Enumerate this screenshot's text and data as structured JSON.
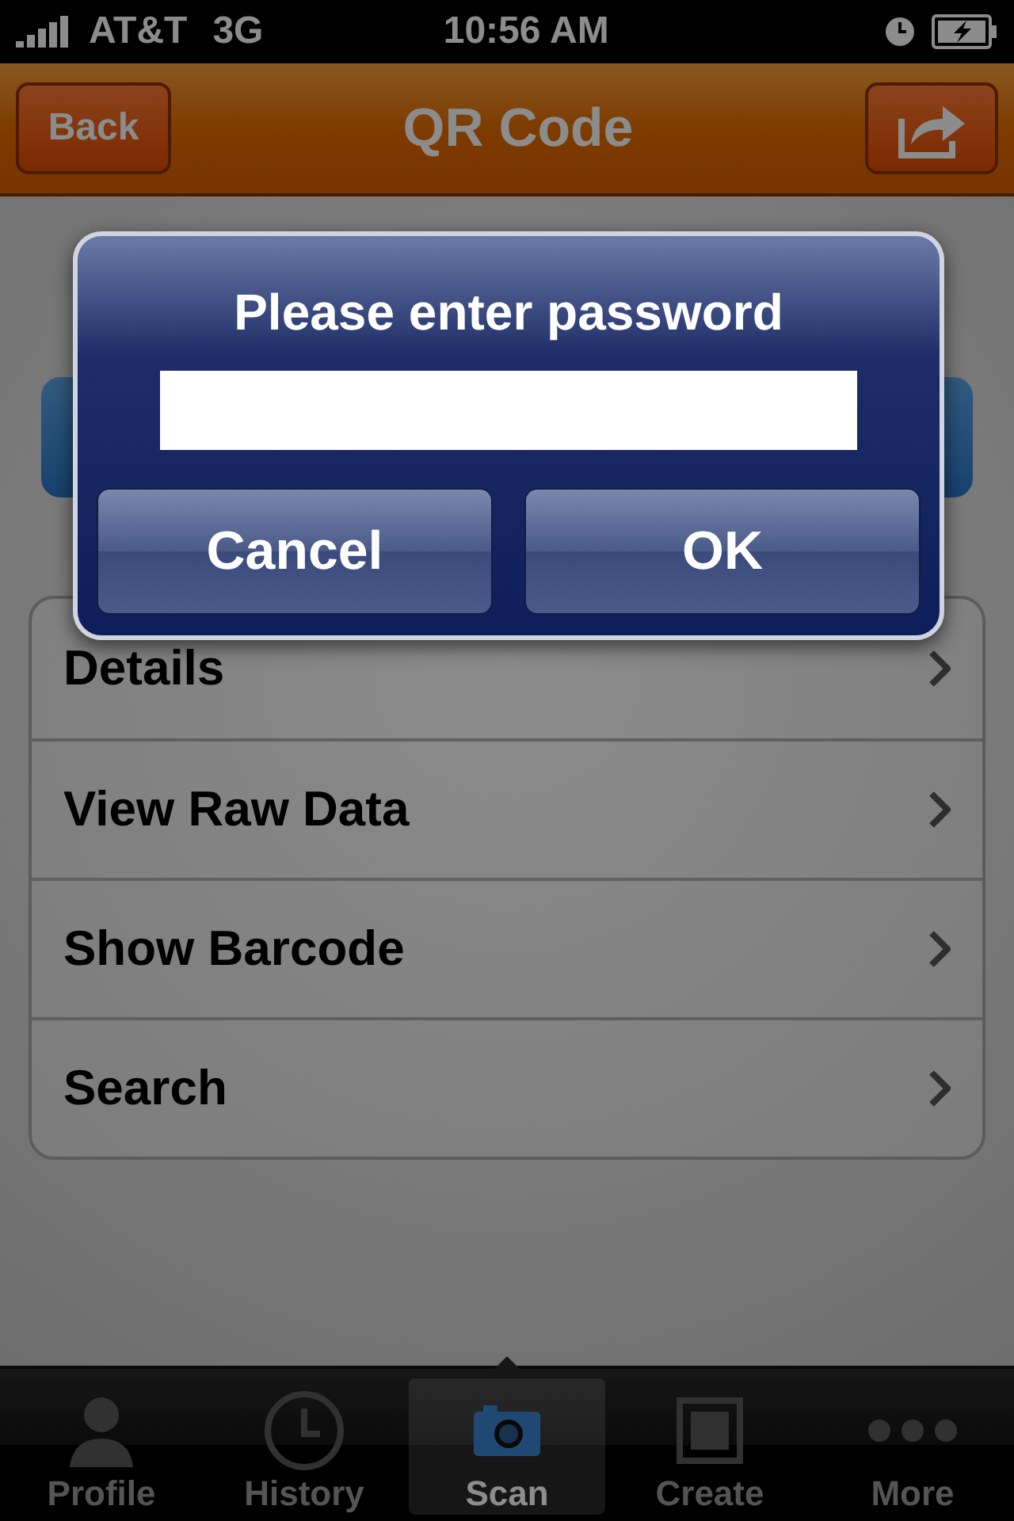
{
  "status_bar": {
    "carrier": "AT&T",
    "network": "3G",
    "time": "10:56 AM"
  },
  "nav_bar": {
    "back": "Back",
    "title": "QR Code"
  },
  "menu": [
    {
      "label": "Details"
    },
    {
      "label": "View Raw Data"
    },
    {
      "label": "Show Barcode"
    },
    {
      "label": "Search"
    }
  ],
  "alert": {
    "title": "Please enter password",
    "buttons": [
      "Cancel",
      "OK"
    ]
  },
  "tab_bar": [
    {
      "label": "Profile",
      "kind": "profile",
      "selected": false
    },
    {
      "label": "History",
      "kind": "history",
      "selected": false
    },
    {
      "label": "Scan",
      "kind": "scan",
      "selected": true
    },
    {
      "label": "Create",
      "kind": "create",
      "selected": false
    },
    {
      "label": "More",
      "kind": "more",
      "selected": false
    }
  ]
}
